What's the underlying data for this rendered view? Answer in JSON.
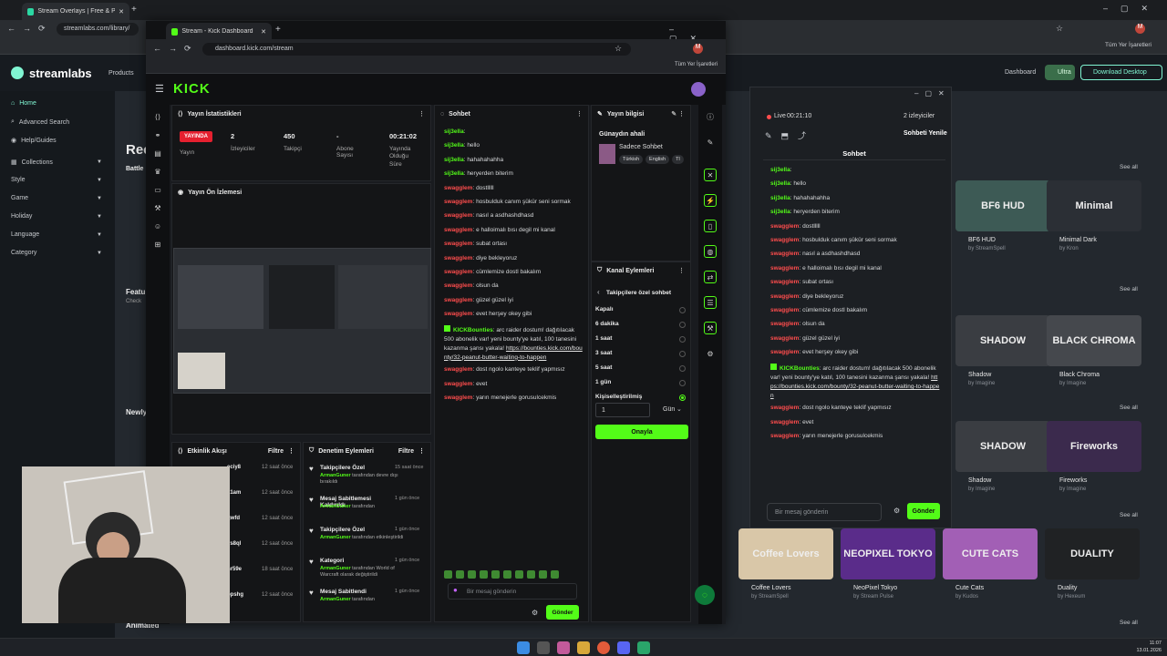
{
  "outer_browser": {
    "tab_title": "Stream Overlays | Free & Premi",
    "url": "streamlabs.com/library/",
    "bookmarks_folder": "Tüm Yer İşaretleri"
  },
  "streamlabs": {
    "logo": "streamlabs",
    "products": "Products",
    "header_links": {
      "dashboard": "Dashboard",
      "ultra": "Ultra",
      "download": "Download Desktop"
    },
    "sidebar": {
      "home": "Home",
      "advanced_search": "Advanced Search",
      "help": "Help/Guides",
      "collections": "Collections",
      "style": "Style",
      "game": "Game",
      "holiday": "Holiday",
      "language": "Language",
      "category": "Category"
    },
    "partial_titles": {
      "rec": "Rec",
      "battle": "Battle",
      "featured": "Featu",
      "check": "Check",
      "newly": "Newly",
      "animated": "Animated"
    },
    "see_all": "See all",
    "overlays": [
      {
        "name": "BF6 HUD",
        "by": "by StreamSpell",
        "thumb": "BF6 HUD",
        "color": "#3d5a55"
      },
      {
        "name": "Minimal Dark",
        "by": "by Kron",
        "thumb": "Minimal",
        "color": "#2b2f35"
      },
      {
        "name": "Shadow",
        "by": "by Imagine",
        "thumb": "SHADOW",
        "color": "#3a3d42"
      },
      {
        "name": "Black Chroma",
        "by": "by Imagine",
        "thumb": "BLACK CHROMA",
        "color": "#45484d"
      },
      {
        "name": "Shadow",
        "by": "by Imagine",
        "thumb": "SHADOW",
        "color": "#3a3d42"
      },
      {
        "name": "Fireworks",
        "by": "by Imagine",
        "thumb": "Fireworks",
        "color": "#3b2a4d"
      },
      {
        "name": "Coffee Lovers",
        "by": "by StreamSpell",
        "thumb": "Coffee Lovers",
        "color": "#d9c7a8"
      },
      {
        "name": "NeoPixel Tokyo",
        "by": "by Stream Pulse",
        "thumb": "NEOPIXEL TOKYO",
        "color": "#5a2c8a"
      },
      {
        "name": "Cute Cats",
        "by": "by Kudos",
        "thumb": "CUTE CATS",
        "color": "#a25fb5"
      },
      {
        "name": "Duality",
        "by": "by Hexeum",
        "thumb": "DUALITY",
        "color": "#202224"
      }
    ]
  },
  "popout": {
    "live": "Live",
    "live_time": "00:21:10",
    "viewers": "2 izleyiciler",
    "title": "Sohbet",
    "refresh": "Sohbeti Yenile",
    "input_placeholder": "Bir mesaj gönderin",
    "send": "Gönder"
  },
  "front_browser": {
    "tab_title": "Stream - Kick Dashboard",
    "url": "dashboard.kick.com/stream",
    "bookmarks_folder": "Tüm Yer İşaretleri"
  },
  "kick": {
    "logo": "KICK",
    "stats": {
      "title": "Yayın İstatistikleri",
      "live_badge": "YAYINDA",
      "broadcast_label": "Yayın",
      "viewers_value": "2",
      "viewers_label": "İzleyiciler",
      "followers_value": "450",
      "followers_label": "Takipçi",
      "subs_value": "-",
      "subs_label": "Abone Sayısı",
      "duration_value": "00:21:02",
      "duration_label": "Yayında Olduğu Süre"
    },
    "preview_title": "Yayın Ön İzlemesi",
    "chat": {
      "title": "Sohbet",
      "messages": [
        {
          "user": "sij3ella",
          "color": "g",
          "text": ""
        },
        {
          "user": "sij3ella",
          "color": "g",
          "text": "hello"
        },
        {
          "user": "sij3ella",
          "color": "g",
          "text": "hahahahahha"
        },
        {
          "user": "sij3ella",
          "color": "g",
          "text": "heryerden biterim"
        },
        {
          "user": "swagglem",
          "color": "r",
          "text": "dostlllll"
        },
        {
          "user": "swagglem",
          "color": "r",
          "text": "hosbulduk canım şükür seni sormak"
        },
        {
          "user": "swagglem",
          "color": "r",
          "text": "nasıl a asdhashdhasd"
        },
        {
          "user": "swagglem",
          "color": "r",
          "text": "e halloimalı bısı degil mi kanal"
        },
        {
          "user": "swagglem",
          "color": "r",
          "text": "subat ortası"
        },
        {
          "user": "swagglem",
          "color": "r",
          "text": "diye bekleyoruz"
        },
        {
          "user": "swagglem",
          "color": "r",
          "text": "cümlemize dostl bakalım"
        },
        {
          "user": "swagglem",
          "color": "r",
          "text": "olsun da"
        },
        {
          "user": "swagglem",
          "color": "r",
          "text": "güzel güzel iyi"
        },
        {
          "user": "swagglem",
          "color": "r",
          "text": "evet herşey okey gibi"
        }
      ],
      "bot_user": "KICKBounties",
      "bot_text": "arc raider dostum! dağıtılacak 500 abonelik var! yeni bounty'ye katıl, 100 tanesini kazanma şansı yakala!",
      "bot_link": "https://bounties.kick.com/bounty/32-peanut-butter-waiting-to-happen",
      "after_messages": [
        {
          "user": "swagglem",
          "color": "r",
          "text": "dost ngolo kanteye teklif yapmısız"
        },
        {
          "user": "swagglem",
          "color": "r",
          "text": "evet"
        },
        {
          "user": "swagglem",
          "color": "r",
          "text": "yarın menejerle gorusulcekmis"
        }
      ],
      "input_placeholder": "Bir mesaj gönderin",
      "send": "Gönder"
    },
    "stream_info": {
      "title": "Yayın bilgisi",
      "stream_title": "Günaydın ahali",
      "category": "Sadece Sohbet",
      "tags": [
        "Türkish",
        "English",
        "Tl"
      ]
    },
    "channel_actions": {
      "title": "Kanal Eylemleri",
      "subtitle": "Takipçilere özel sohbet",
      "options": [
        "Kapalı",
        "6 dakika",
        "1 saat",
        "3 saat",
        "5 saat",
        "1 gün",
        "Kişiselleştirilmiş"
      ],
      "selected": "Kişiselleştirilmiş",
      "amount": "1",
      "unit": "Gün",
      "confirm": "Onayla"
    },
    "activity": {
      "title": "Etkinlik Akışı",
      "filter": "Filtre",
      "rows": [
        {
          "user": "eciy8",
          "time": "12 saat önce"
        },
        {
          "user": "k1am",
          "time": "12 saat önce"
        },
        {
          "user": "gwfd",
          "time": "12 saat önce"
        },
        {
          "user": "ys8ql",
          "time": "12 saat önce"
        },
        {
          "user": "hr59e",
          "time": "18 saat önce"
        },
        {
          "user": "bpshg",
          "time": "12 saat önce"
        }
      ]
    },
    "moderation": {
      "title": "Denetim Eylemleri",
      "filter": "Filtre",
      "rows": [
        {
          "title": "Takipçilere Özel",
          "actor": "ArmanGuner",
          "desc": "tarafından devre dışı bırakıldı",
          "time": "15 saat önce"
        },
        {
          "title": "Mesaj Sabitlemesi Kaldırıldı",
          "actor": "ArmanGuner",
          "desc": "tarafından",
          "time": "1 gün önce"
        },
        {
          "title": "Takipçilere Özel",
          "actor": "ArmanGuner",
          "desc": "tarafından etkinleştirildi",
          "time": "1 gün önce"
        },
        {
          "title": "Kategori",
          "actor": "ArmanGuner",
          "desc": "tarafından World of Warcraft olarak değiştirildi",
          "time": "1 gün önce"
        },
        {
          "title": "Mesaj Sabitlendi",
          "actor": "ArmanGuner",
          "desc": "tarafından",
          "time": "1 gün önce"
        }
      ]
    }
  },
  "taskbar": {
    "time": "11:07",
    "date": "13.01.2026"
  }
}
